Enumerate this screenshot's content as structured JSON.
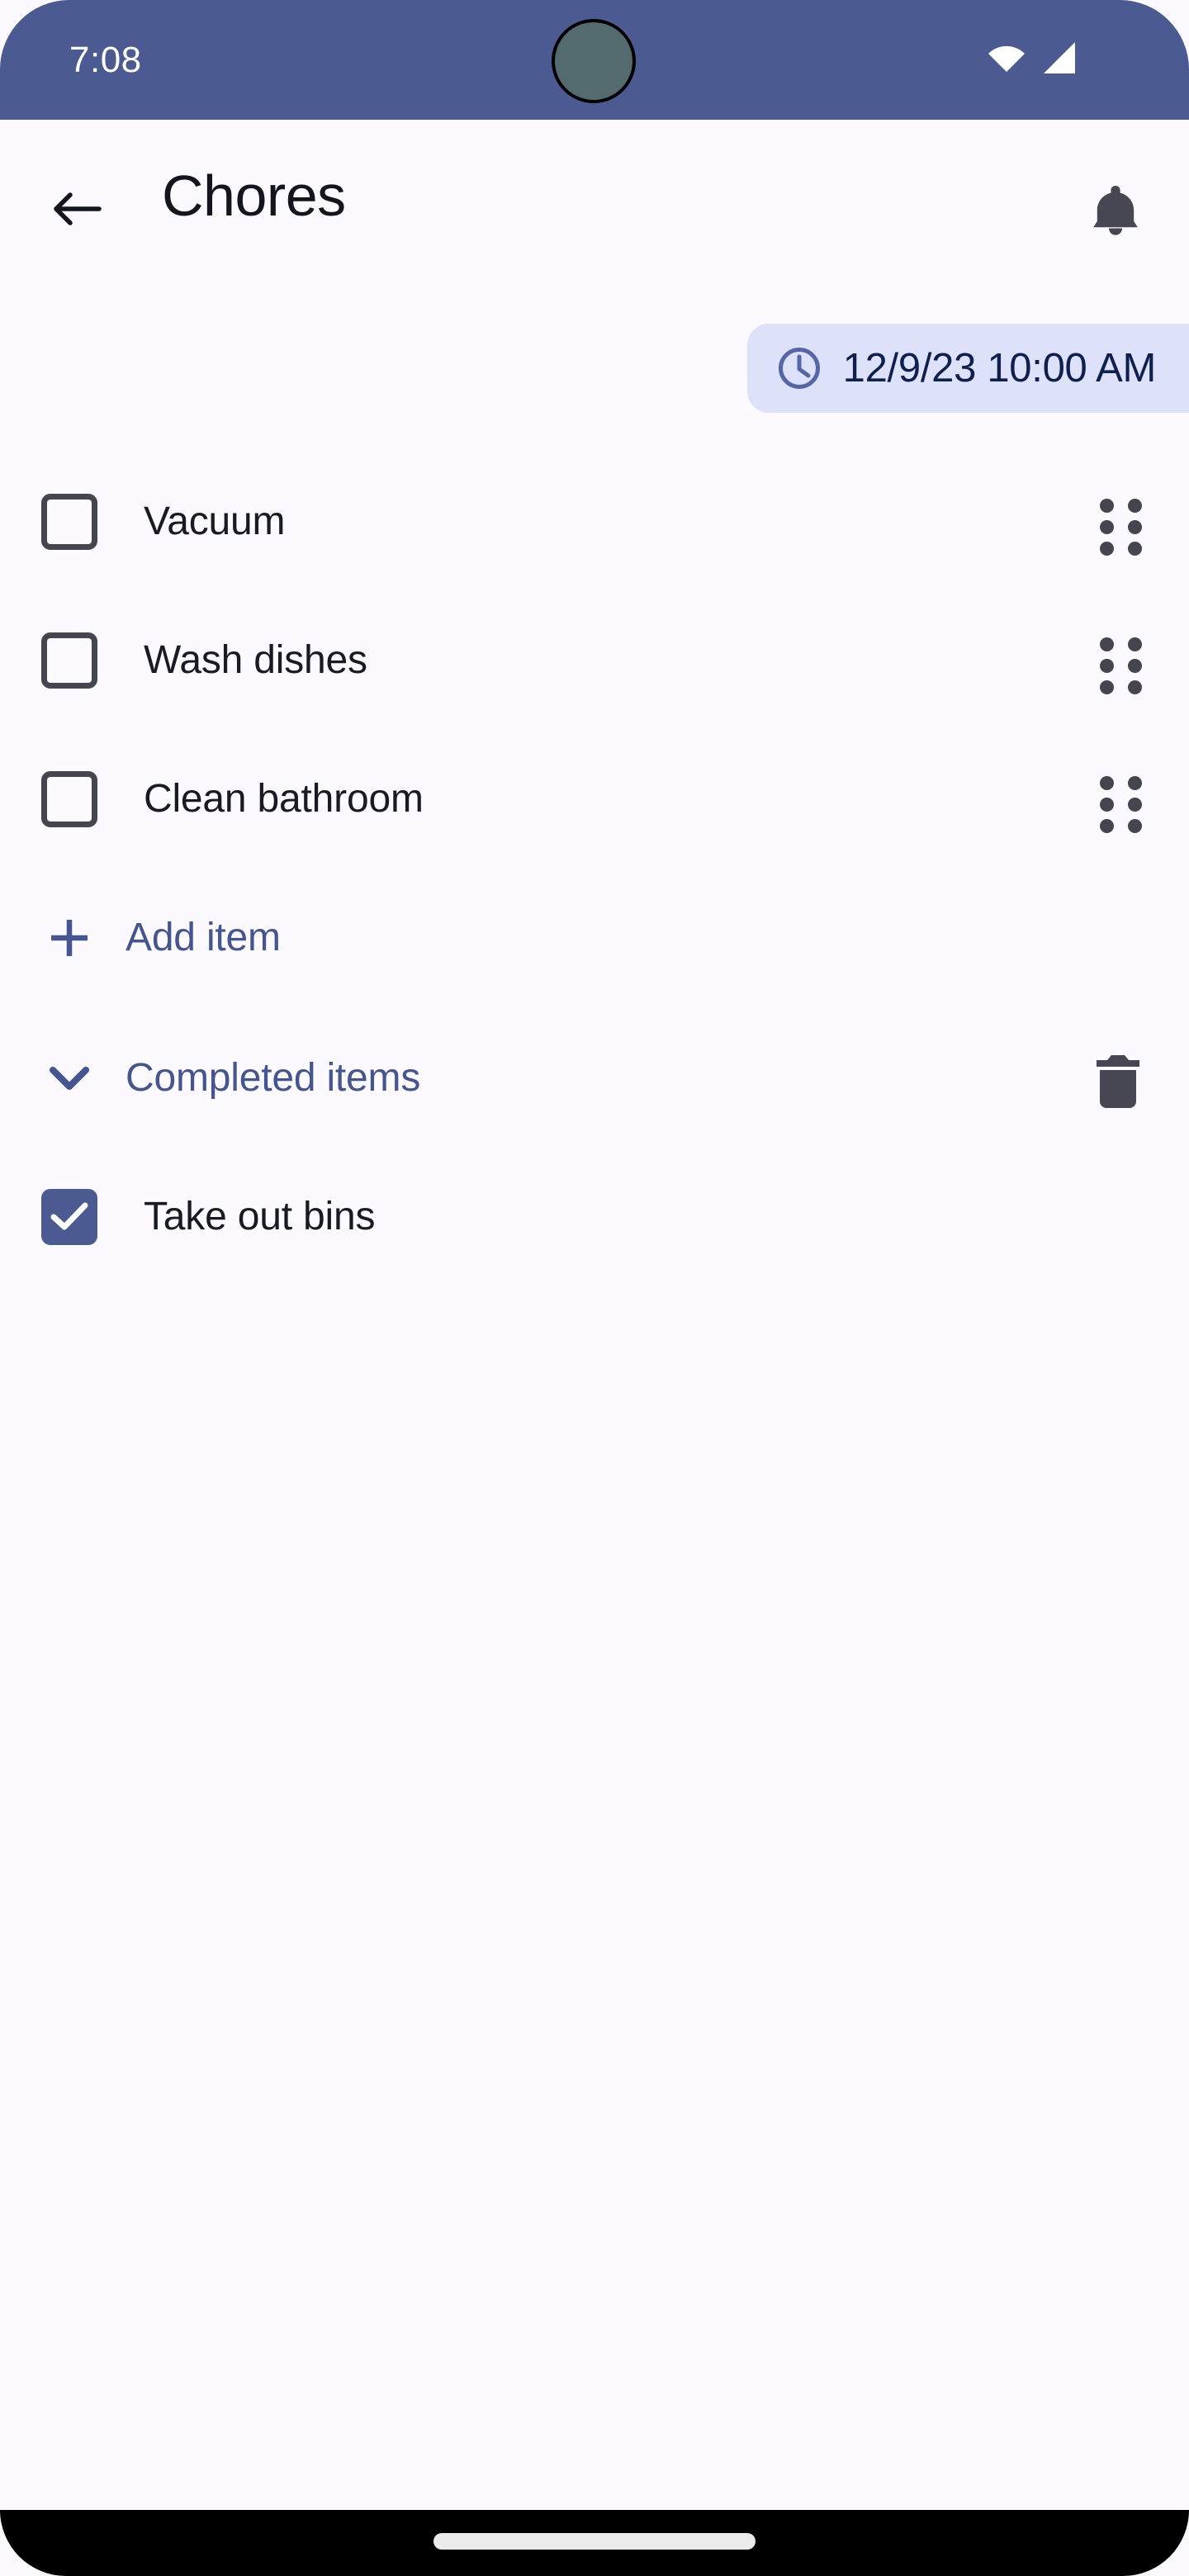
{
  "status_bar": {
    "time": "7:08",
    "wifi_icon": "wifi-icon",
    "signal_icon": "cell-signal-icon",
    "camera_icon": "front-camera-cutout",
    "background_color": "#4b5b92"
  },
  "app_bar": {
    "back_icon": "arrow-left-icon",
    "title": "Chores",
    "notification_icon": "bell-icon"
  },
  "date_chip": {
    "icon": "clock-icon",
    "text": "12/9/23 10:00 AM",
    "background_color": "#dde1fa",
    "text_color": "#10204c"
  },
  "tasks": [
    {
      "label": "Vacuum",
      "checked": false,
      "handle_icon": "drag-handle-icon"
    },
    {
      "label": "Wash dishes",
      "checked": false,
      "handle_icon": "drag-handle-icon"
    },
    {
      "label": "Clean bathroom",
      "checked": false,
      "handle_icon": "drag-handle-icon"
    }
  ],
  "add_item": {
    "icon": "plus-icon",
    "label": "Add item"
  },
  "completed_section": {
    "chevron_icon": "chevron-down-icon",
    "label": "Completed items",
    "delete_icon": "trash-icon",
    "items": [
      {
        "label": "Take out bins",
        "checked": true
      }
    ]
  },
  "nav_bar": {
    "gesture_pill": "home-gesture-pill",
    "background_color": "#000000"
  },
  "theme": {
    "accent": "#4b5b92",
    "link_text": "#44558f",
    "page_background": "#fcfaff",
    "checkbox_border": "#44454f"
  }
}
